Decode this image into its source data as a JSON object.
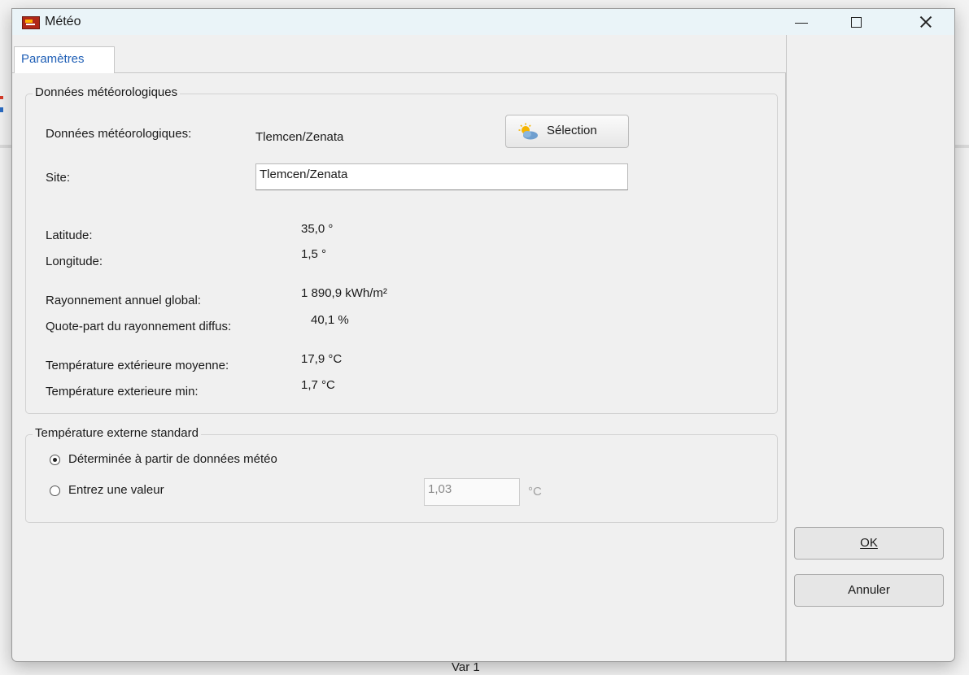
{
  "window": {
    "title": "Météo"
  },
  "tabs": [
    {
      "label": "Paramètres",
      "active": true
    }
  ],
  "weather_group": {
    "legend": "Données météorologiques",
    "weather_data_label": "Données météorologiques:",
    "weather_data_value": "Tlemcen/Zenata",
    "selection_button": "Sélection",
    "site_label": "Site:",
    "site_value": "Tlemcen/Zenata",
    "latitude_label": "Latitude:",
    "latitude_value": "35,0 °",
    "longitude_label": "Longitude:",
    "longitude_value": "1,5 °",
    "radiation_label": "Rayonnement annuel global:",
    "radiation_value": "1 890,9 kWh/m²",
    "diffuse_label": "Quote-part du rayonnement diffus:",
    "diffuse_value": "40,1 %",
    "avg_temp_label": "Température extérieure moyenne:",
    "avg_temp_value": "17,9 °C",
    "min_temp_label": "Température exterieure min:",
    "min_temp_value": "1,7 °C"
  },
  "standard_temp_group": {
    "legend": "Température externe standard",
    "option_weather": "Déterminée à partir de données météo",
    "option_value": "Entrez une valeur",
    "selected_option": "option_weather",
    "value_input": "1,03",
    "value_unit": "°C"
  },
  "buttons": {
    "ok": "OK",
    "cancel": "Annuler"
  },
  "background": {
    "status_text": "Var 1"
  },
  "colors": {
    "tab_text": "#1f5fb6",
    "titlebar": "#eaf4f8",
    "dialog_bg": "#f0f0f0"
  },
  "icons": {
    "app": "app-logo-icon",
    "selection": "weather-sun-cloud-icon"
  }
}
